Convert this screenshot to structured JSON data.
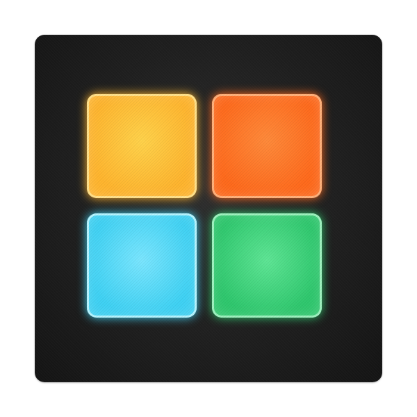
{
  "app_icon": {
    "pads": [
      {
        "name": "pad-yellow",
        "color": "#ffb52e",
        "glow": "#ffd24a",
        "edge": "#ffe08a"
      },
      {
        "name": "pad-orange",
        "color": "#ff6a1c",
        "glow": "#ff8a3a",
        "edge": "#ffb07a"
      },
      {
        "name": "pad-cyan",
        "color": "#3fd2f4",
        "glow": "#7ae6ff",
        "edge": "#b5f4ff"
      },
      {
        "name": "pad-green",
        "color": "#2fc86e",
        "glow": "#5ee695",
        "edge": "#9ef2bf"
      }
    ],
    "background_color": "#1e1e1e"
  }
}
